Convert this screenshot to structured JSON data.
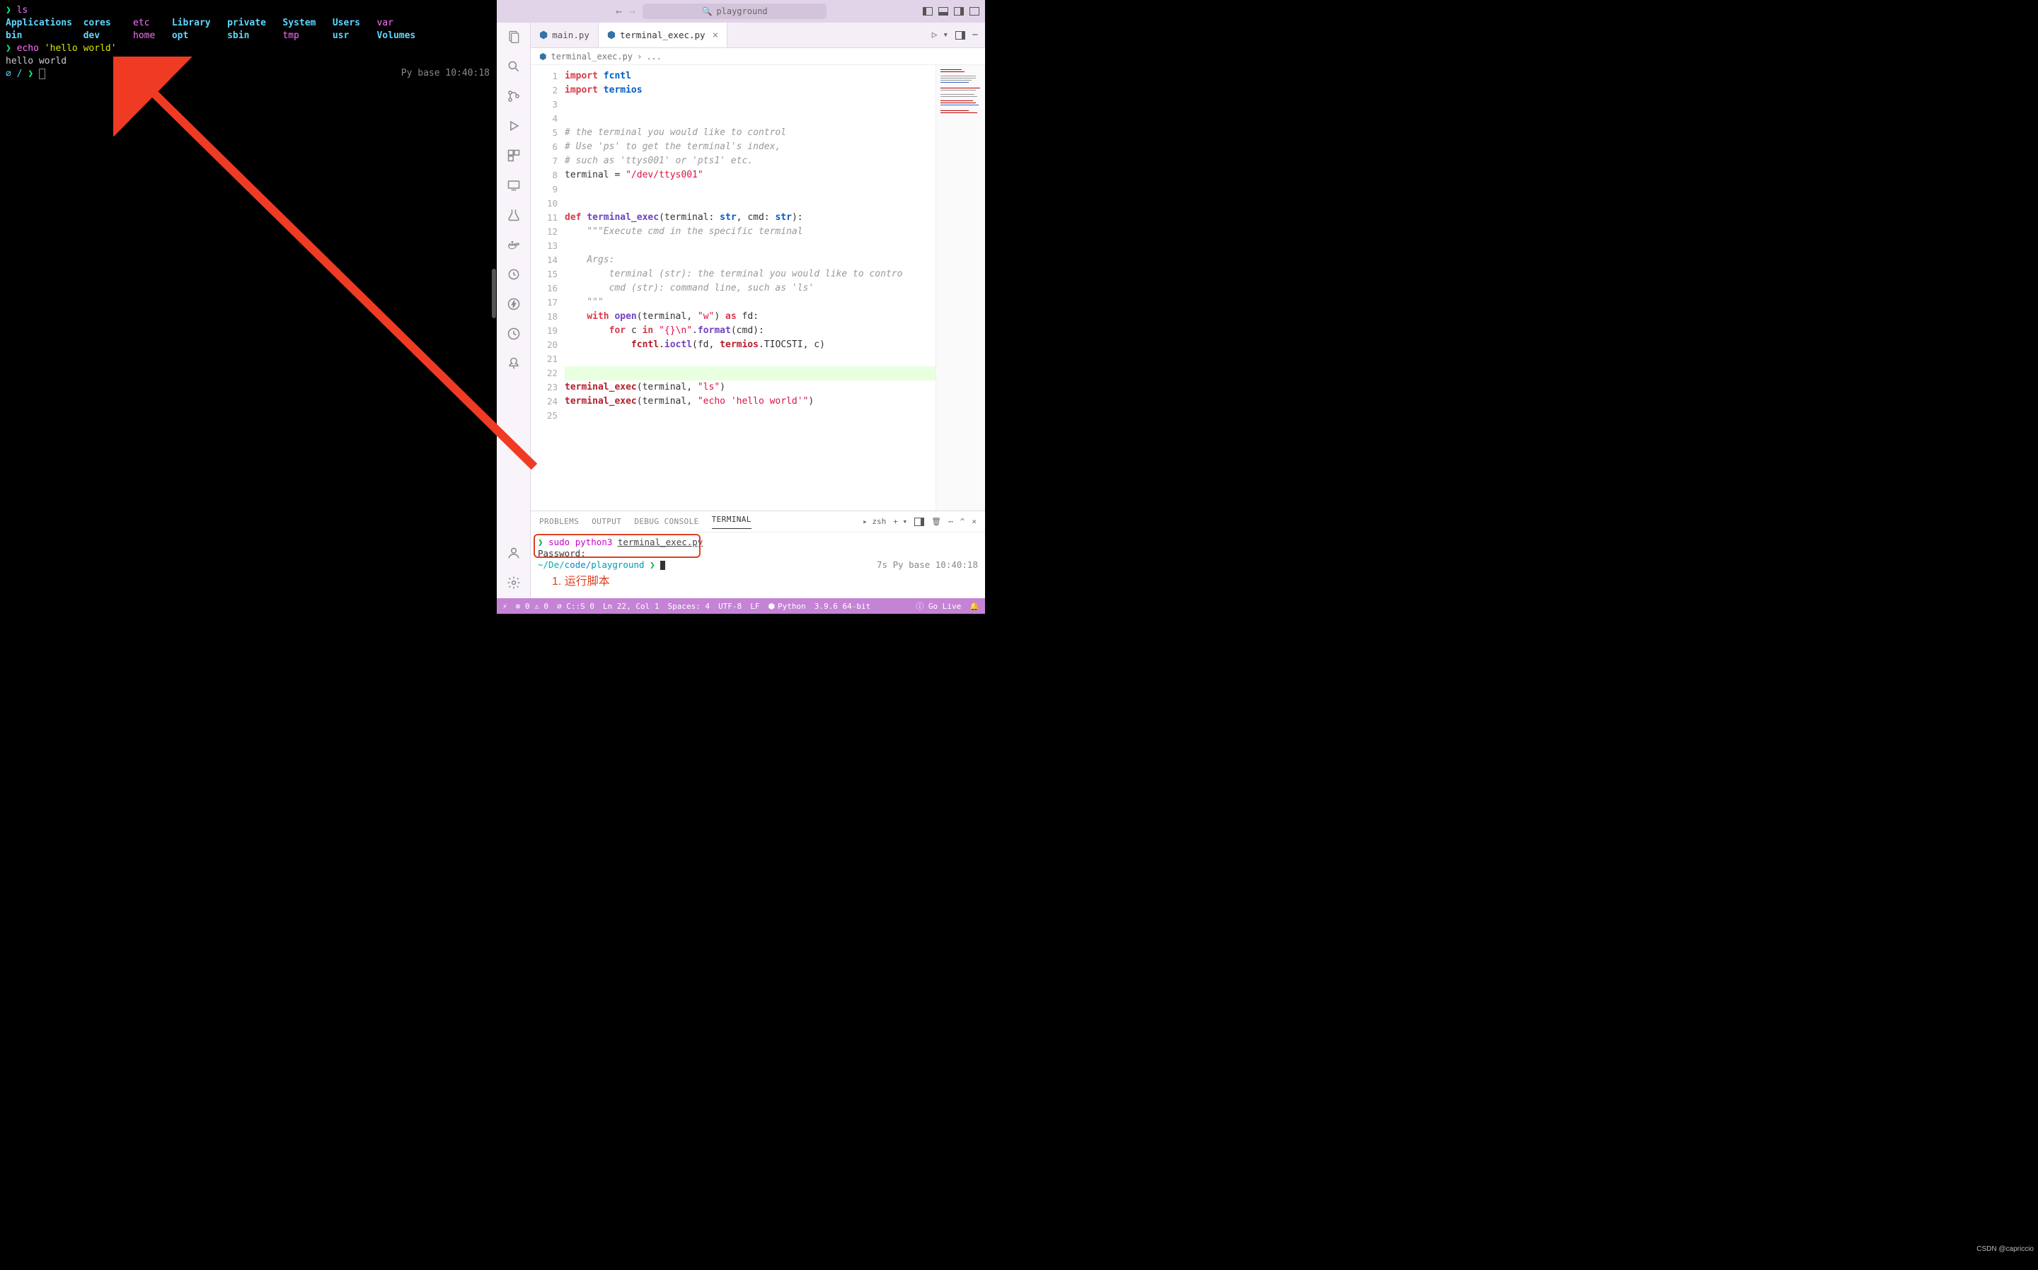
{
  "terminal_left": {
    "cmd1": "ls",
    "row1": [
      "Applications",
      "cores",
      "etc",
      "Library",
      "private",
      "System",
      "Users",
      "var"
    ],
    "row2": [
      "bin",
      "dev",
      "home",
      "opt",
      "sbin",
      "tmp",
      "usr",
      "Volumes"
    ],
    "cmd2_cmd": "echo",
    "cmd2_arg": "'hello world'",
    "output2": "hello world",
    "status_left": "∅ / ",
    "status_right": "Py base 10:40:18"
  },
  "titlebar": {
    "search_placeholder": "playground"
  },
  "tabs": [
    {
      "label": "main.py",
      "active": false
    },
    {
      "label": "terminal_exec.py",
      "active": true
    }
  ],
  "breadcrumb": {
    "file": "terminal_exec.py",
    "sep": "›",
    "sym": "..."
  },
  "code_lines": [
    {
      "n": 1,
      "html": "<span class='kw'>import</span> <span class='type'>fcntl</span>"
    },
    {
      "n": 2,
      "html": "<span class='kw'>import</span> <span class='type'>termios</span>"
    },
    {
      "n": 3,
      "html": ""
    },
    {
      "n": 4,
      "html": ""
    },
    {
      "n": 5,
      "html": "<span class='com'># the terminal you would like to control</span>"
    },
    {
      "n": 6,
      "html": "<span class='com'># Use 'ps' to get the terminal's index,</span>"
    },
    {
      "n": 7,
      "html": "<span class='com'># such as 'ttys001' or 'pts1' etc.</span>"
    },
    {
      "n": 8,
      "html": "<span class='ident'>terminal</span> <span class='op'>=</span> <span class='strlit'>\"/dev/ttys001\"</span>"
    },
    {
      "n": 9,
      "html": ""
    },
    {
      "n": 10,
      "html": ""
    },
    {
      "n": 11,
      "html": "<span class='kw'>def</span> <span class='fnname'>terminal_exec</span><span class='par'>(</span><span class='ident'>terminal</span><span class='op'>:</span> <span class='type'>str</span><span class='op'>,</span> <span class='ident'>cmd</span><span class='op'>:</span> <span class='type'>str</span><span class='par'>)</span><span class='op'>:</span>"
    },
    {
      "n": 12,
      "html": "    <span class='com'>\"\"\"Execute cmd in the specific terminal</span>"
    },
    {
      "n": 13,
      "html": ""
    },
    {
      "n": 14,
      "html": "    <span class='com'>Args:</span>"
    },
    {
      "n": 15,
      "html": "        <span class='com'>terminal (str): the terminal you would like to contro</span>"
    },
    {
      "n": 16,
      "html": "        <span class='com'>cmd (str): command line, such as 'ls'</span>"
    },
    {
      "n": 17,
      "html": "    <span class='com'>\"\"\"</span>"
    },
    {
      "n": 18,
      "html": "    <span class='kw'>with</span> <span class='fnname'>open</span><span class='par'>(</span><span class='ident'>terminal</span><span class='op'>,</span> <span class='strlit'>\"w\"</span><span class='par'>)</span> <span class='kw'>as</span> <span class='ident'>fd</span><span class='op'>:</span>"
    },
    {
      "n": 19,
      "html": "        <span class='kw'>for</span> <span class='ident'>c</span> <span class='kw'>in</span> <span class='strlit'>\"{}<span>\\n</span>\"</span><span class='op'>.</span><span class='fnname'>format</span><span class='par'>(</span><span class='ident'>cmd</span><span class='par'>)</span><span class='op'>:</span>"
    },
    {
      "n": 20,
      "html": "            <span class='call'>fcntl</span><span class='op'>.</span><span class='fnname'>ioctl</span><span class='par'>(</span><span class='ident'>fd</span><span class='op'>,</span> <span class='call'>termios</span><span class='op'>.</span><span class='ident'>TIOCSTI</span><span class='op'>,</span> <span class='ident'>c</span><span class='par'>)</span>"
    },
    {
      "n": 21,
      "html": ""
    },
    {
      "n": 22,
      "html": "",
      "hl": true
    },
    {
      "n": 23,
      "html": "<span class='call'>terminal_exec</span><span class='par'>(</span><span class='ident'>terminal</span><span class='op'>,</span> <span class='strlit'>\"ls\"</span><span class='par'>)</span>"
    },
    {
      "n": 24,
      "html": "<span class='call'>terminal_exec</span><span class='par'>(</span><span class='ident'>terminal</span><span class='op'>,</span> <span class='strlit'>\"echo 'hello world'\"</span><span class='par'>)</span>"
    },
    {
      "n": 25,
      "html": ""
    }
  ],
  "panel": {
    "tabs": [
      "PROBLEMS",
      "OUTPUT",
      "DEBUG CONSOLE",
      "TERMINAL"
    ],
    "active_tab": "TERMINAL",
    "shell_label": "zsh",
    "term_prompt": "❯",
    "term_cmd": "sudo python3",
    "term_arg": "terminal_exec.py",
    "pwd_line": "Password:",
    "path1": "~/De/",
    "path2": "code/",
    "path3": "playground",
    "right_status": "7s Py base 10:40:18",
    "annotation": "1. 运行脚本"
  },
  "statusbar": {
    "remote": "⚡",
    "errors": "⊗ 0 ⚠ 0",
    "csspell": "⌀ C::S 0",
    "pos": "Ln 22, Col 1",
    "spaces": "Spaces: 4",
    "enc": "UTF-8",
    "eol": "LF",
    "lang": "Python",
    "py": "3.9.6 64-bit",
    "golive": "ⓘ Go Live",
    "bell": "🔔"
  }
}
